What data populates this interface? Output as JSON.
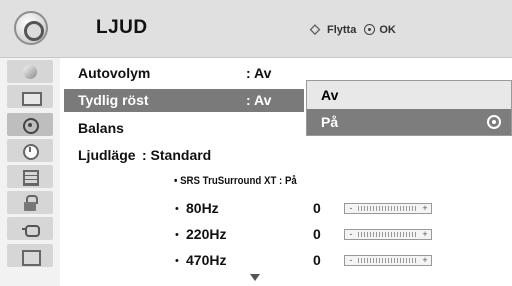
{
  "header": {
    "title": "LJUD",
    "hint_move": "Flytta",
    "hint_ok": "OK",
    "menu_icon": "audio-menu-icon"
  },
  "rail": {
    "items": [
      {
        "icon": "picture-icon"
      },
      {
        "icon": "screen-icon"
      },
      {
        "icon": "audio-icon",
        "active": true
      },
      {
        "icon": "time-icon"
      },
      {
        "icon": "option-grid-icon"
      },
      {
        "icon": "lock-icon"
      },
      {
        "icon": "input-plug-icon"
      },
      {
        "icon": "photo-music-icon"
      }
    ]
  },
  "menu": {
    "items": [
      {
        "label": "Autovolym",
        "value": ": Av"
      },
      {
        "label": "Tydlig röst",
        "value": ": Av",
        "selected": true
      },
      {
        "label": "Balans",
        "value": ""
      },
      {
        "label": "Ljudläge",
        "value": ": Standard"
      }
    ],
    "srs": {
      "label": "SRS TruSurround XT : På"
    },
    "eq": [
      {
        "label": "80Hz",
        "value": "0",
        "level": 0.5
      },
      {
        "label": "220Hz",
        "value": "0",
        "level": 0.5
      },
      {
        "label": "470Hz",
        "value": "0",
        "level": 0.5
      }
    ],
    "bullet": "•",
    "slider_minus": "-",
    "slider_plus": "+"
  },
  "popup": {
    "options": [
      {
        "label": "Av"
      },
      {
        "label": "På",
        "selected": true
      }
    ]
  }
}
